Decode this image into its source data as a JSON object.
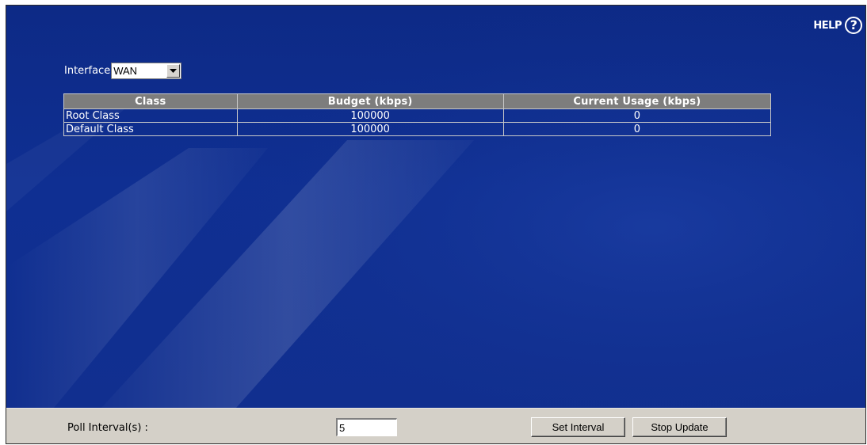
{
  "help": {
    "label": "HELP",
    "icon_glyph": "?",
    "icon": "help-icon"
  },
  "interface": {
    "label": "Interface",
    "selected": "WAN"
  },
  "table": {
    "headers": [
      "Class",
      "Budget (kbps)",
      "Current Usage (kbps)"
    ],
    "rows": [
      {
        "class": "Root Class",
        "budget": "100000",
        "usage": "0"
      },
      {
        "class": "Default Class",
        "budget": "100000",
        "usage": "0"
      }
    ]
  },
  "poll": {
    "label": "Poll Interval(s) :",
    "value": "5",
    "set_button": "Set Interval",
    "stop_button": "Stop Update"
  },
  "colors": {
    "background_blue": "#0f2f92",
    "header_gray": "#7d7d7d",
    "bottom_bar": "#d4d0c8"
  }
}
